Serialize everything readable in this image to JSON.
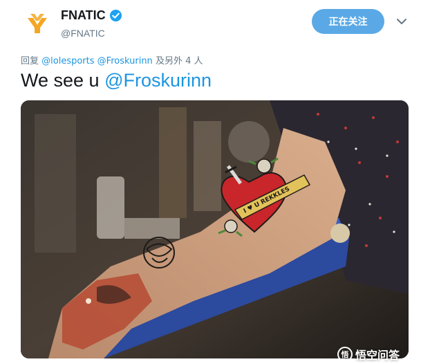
{
  "account": {
    "display_name": "FNATIC",
    "handle": "@FNATIC",
    "verified": true,
    "avatar_icon": "fnatic-logo-icon",
    "brand_color": "#f5a623"
  },
  "follow_button": {
    "label": "正在关注",
    "color": "#5aa9e6"
  },
  "menu_icon": "chevron-down-icon",
  "reply": {
    "prefix": "回复",
    "mentions": [
      "@lolesports",
      "@Froskurinn"
    ],
    "suffix": "及另外 4 人"
  },
  "tweet": {
    "text": "We see u",
    "mention": "@Froskurinn"
  },
  "media": {
    "tattoo_text": "I ♥ U REKKLES"
  },
  "watermark": {
    "icon": "wukong-icon",
    "icon_glyph": "悟",
    "text": "悟空问答"
  },
  "colors": {
    "link": "#1b95e0",
    "muted": "#657786",
    "text": "#14171a"
  }
}
